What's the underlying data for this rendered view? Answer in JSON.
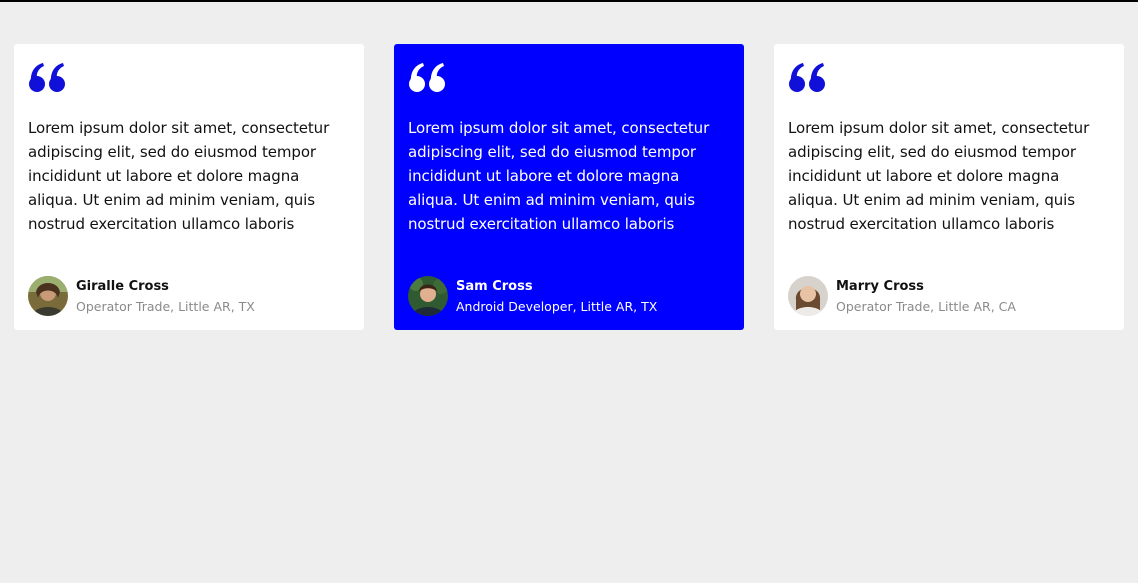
{
  "colors": {
    "background": "#eeeeee",
    "card": "#ffffff",
    "featured_card": "#0000ff",
    "quote_accent": "#1010d8",
    "muted_text": "#8a8a8a"
  },
  "testimonials": [
    {
      "icon": "quote-icon",
      "text": "Lorem ipsum dolor sit amet, consectetur adipiscing elit, sed do eiusmod tempor incididunt ut labore et dolore magna aliqua. Ut enim ad minim veniam, quis nostrud exercitation ullamco laboris",
      "name": "Giralle Cross",
      "role": "Operator Trade, Little AR, TX",
      "featured": false
    },
    {
      "icon": "quote-icon",
      "text": "Lorem ipsum dolor sit amet, consectetur adipiscing elit, sed do eiusmod tempor incididunt ut labore et dolore magna aliqua. Ut enim ad minim veniam, quis nostrud exercitation ullamco laboris",
      "name": "Sam Cross",
      "role": "Android Developer, Little AR, TX",
      "featured": true
    },
    {
      "icon": "quote-icon",
      "text": "Lorem ipsum dolor sit amet, consectetur adipiscing elit, sed do eiusmod tempor incididunt ut labore et dolore magna aliqua. Ut enim ad minim veniam, quis nostrud exercitation ullamco laboris",
      "name": "Marry Cross",
      "role": "Operator Trade, Little AR, CA",
      "featured": false
    }
  ]
}
